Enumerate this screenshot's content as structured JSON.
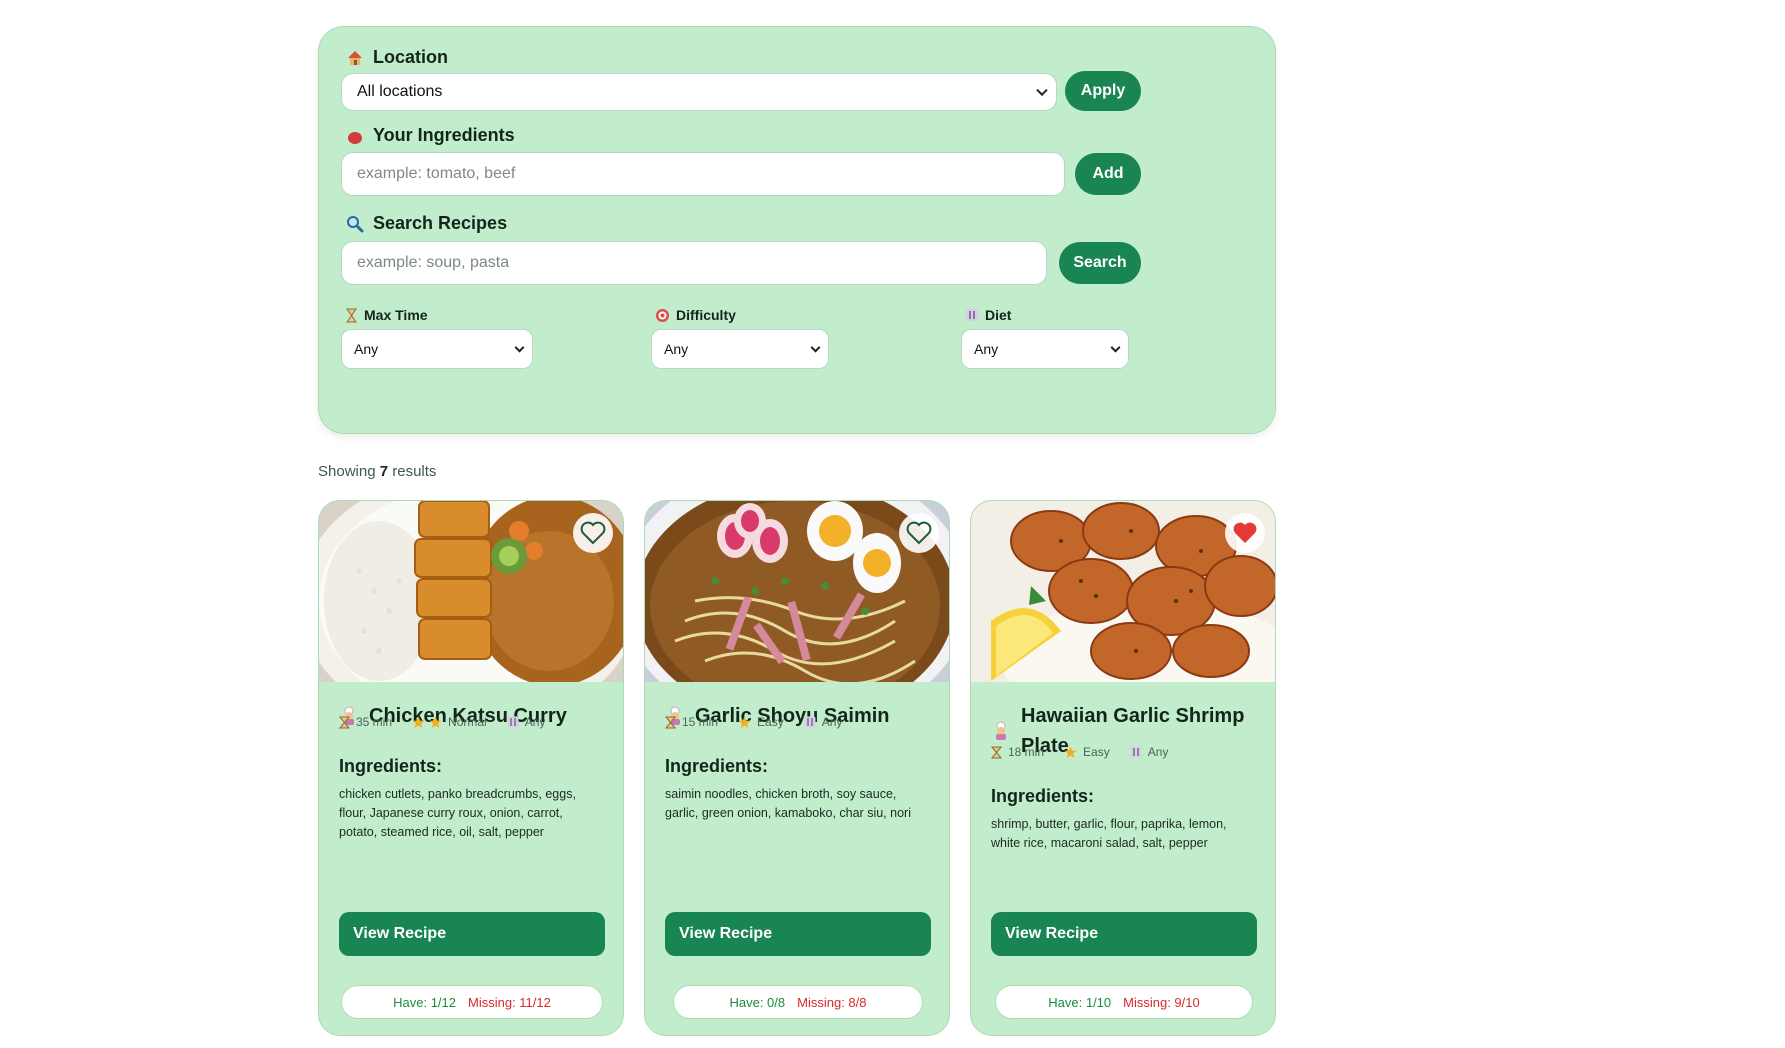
{
  "filters": {
    "location": {
      "label": "Location",
      "value": "All locations",
      "apply_label": "Apply"
    },
    "ingredients": {
      "label": "Your Ingredients",
      "placeholder": "example: tomato, beef",
      "add_label": "Add"
    },
    "search": {
      "label": "Search Recipes",
      "placeholder": "example: soup, pasta",
      "search_label": "Search"
    },
    "max_time": {
      "label": "Max Time",
      "value": "Any"
    },
    "difficulty": {
      "label": "Difficulty",
      "value": "Any"
    },
    "diet": {
      "label": "Diet",
      "value": "Any"
    }
  },
  "results": {
    "prefix": "Showing",
    "count": "7",
    "suffix": "results"
  },
  "recipes": [
    {
      "title": "Chicken Katsu Curry",
      "time": "35 min",
      "difficulty": "Normal",
      "difficulty_stars": 2,
      "diet": "Any",
      "ingredients_heading": "Ingredients:",
      "ingredients": "chicken cutlets, panko breadcrumbs, eggs, flour, Japanese curry roux, onion, carrot, potato, steamed rice, oil, salt, pepper",
      "view_label": "View Recipe",
      "have": "Have: 1/12",
      "missing": "Missing: 11/12",
      "favorited": false
    },
    {
      "title": "Garlic Shoyu Saimin",
      "time": "15 min",
      "difficulty": "Easy",
      "difficulty_stars": 1,
      "diet": "Any",
      "ingredients_heading": "Ingredients:",
      "ingredients": "saimin noodles, chicken broth, soy sauce, garlic, green onion, kamaboko, char siu, nori",
      "view_label": "View Recipe",
      "have": "Have: 0/8",
      "missing": "Missing: 8/8",
      "favorited": false
    },
    {
      "title": "Hawaiian Garlic Shrimp Plate",
      "time": "18 min",
      "difficulty": "Easy",
      "difficulty_stars": 1,
      "diet": "Any",
      "ingredients_heading": "Ingredients:",
      "ingredients": "shrimp, butter, garlic, flour, paprika, lemon, white rice, macaroni salad, salt, pepper",
      "view_label": "View Recipe",
      "have": "Have: 1/10",
      "missing": "Missing: 9/10",
      "favorited": true
    }
  ],
  "colors": {
    "panel": "#c2edcc",
    "accent": "#198552",
    "have": "#1c8c3e",
    "missing": "#d82a2a",
    "heart_active": "#e53935"
  }
}
